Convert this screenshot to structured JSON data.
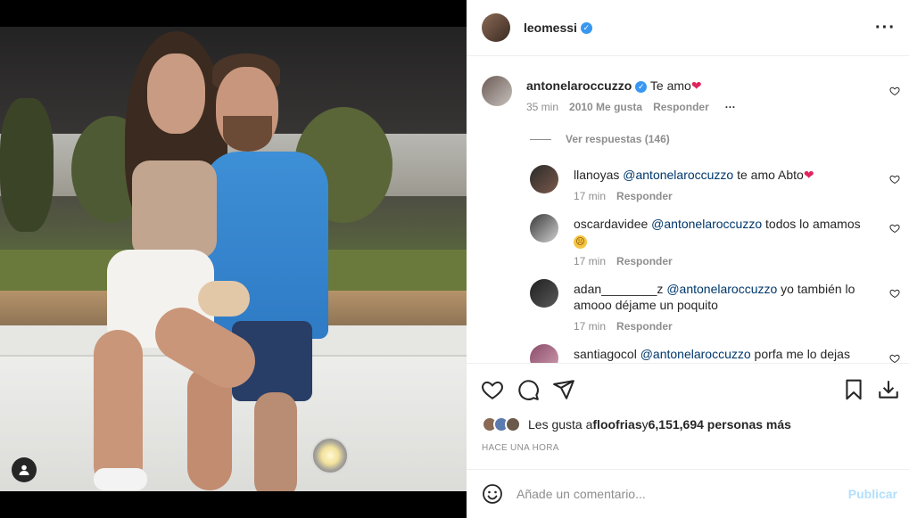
{
  "post": {
    "author": "leomessi",
    "more_icon": "more-horizontal-icon"
  },
  "main_comment": {
    "username": "antonelaroccuzzo",
    "text": "Te amo",
    "time": "35 min",
    "likes": "2010 Me gusta",
    "reply_label": "Responder",
    "view_replies": "Ver respuestas (146)"
  },
  "replies": [
    {
      "username": "llanoyas",
      "mention": "@antonelaroccuzzo",
      "text": " te amo Abto",
      "time": "17 min",
      "reply_label": "Responder"
    },
    {
      "username": "oscardavidee",
      "mention": "@antonelaroccuzzo",
      "text": " todos lo amamos",
      "time": "17 min",
      "reply_label": "Responder"
    },
    {
      "username": "adan________z",
      "mention": "@antonelaroccuzzo",
      "text": " yo también lo amooo déjame un poquito",
      "time": "17 min",
      "reply_label": "Responder"
    },
    {
      "username": "santiagocol",
      "mention": "@antonelaroccuzzo",
      "text": " porfa me lo dejas",
      "time": "",
      "reply_label": ""
    }
  ],
  "likes_summary": {
    "prefix": "Les gusta a ",
    "first_user": "floofrias",
    "middle": " y ",
    "count": "6,151,694 personas más"
  },
  "timestamp": "HACE UNA HORA",
  "comment_input": {
    "placeholder": "Añade un comentario...",
    "publish_label": "Publicar"
  },
  "colors": {
    "verified": "#3897f0",
    "heart": "#ed4956",
    "publish_disabled": "#b2dffc",
    "mention": "#00376b",
    "muted": "#8e8e8e"
  }
}
